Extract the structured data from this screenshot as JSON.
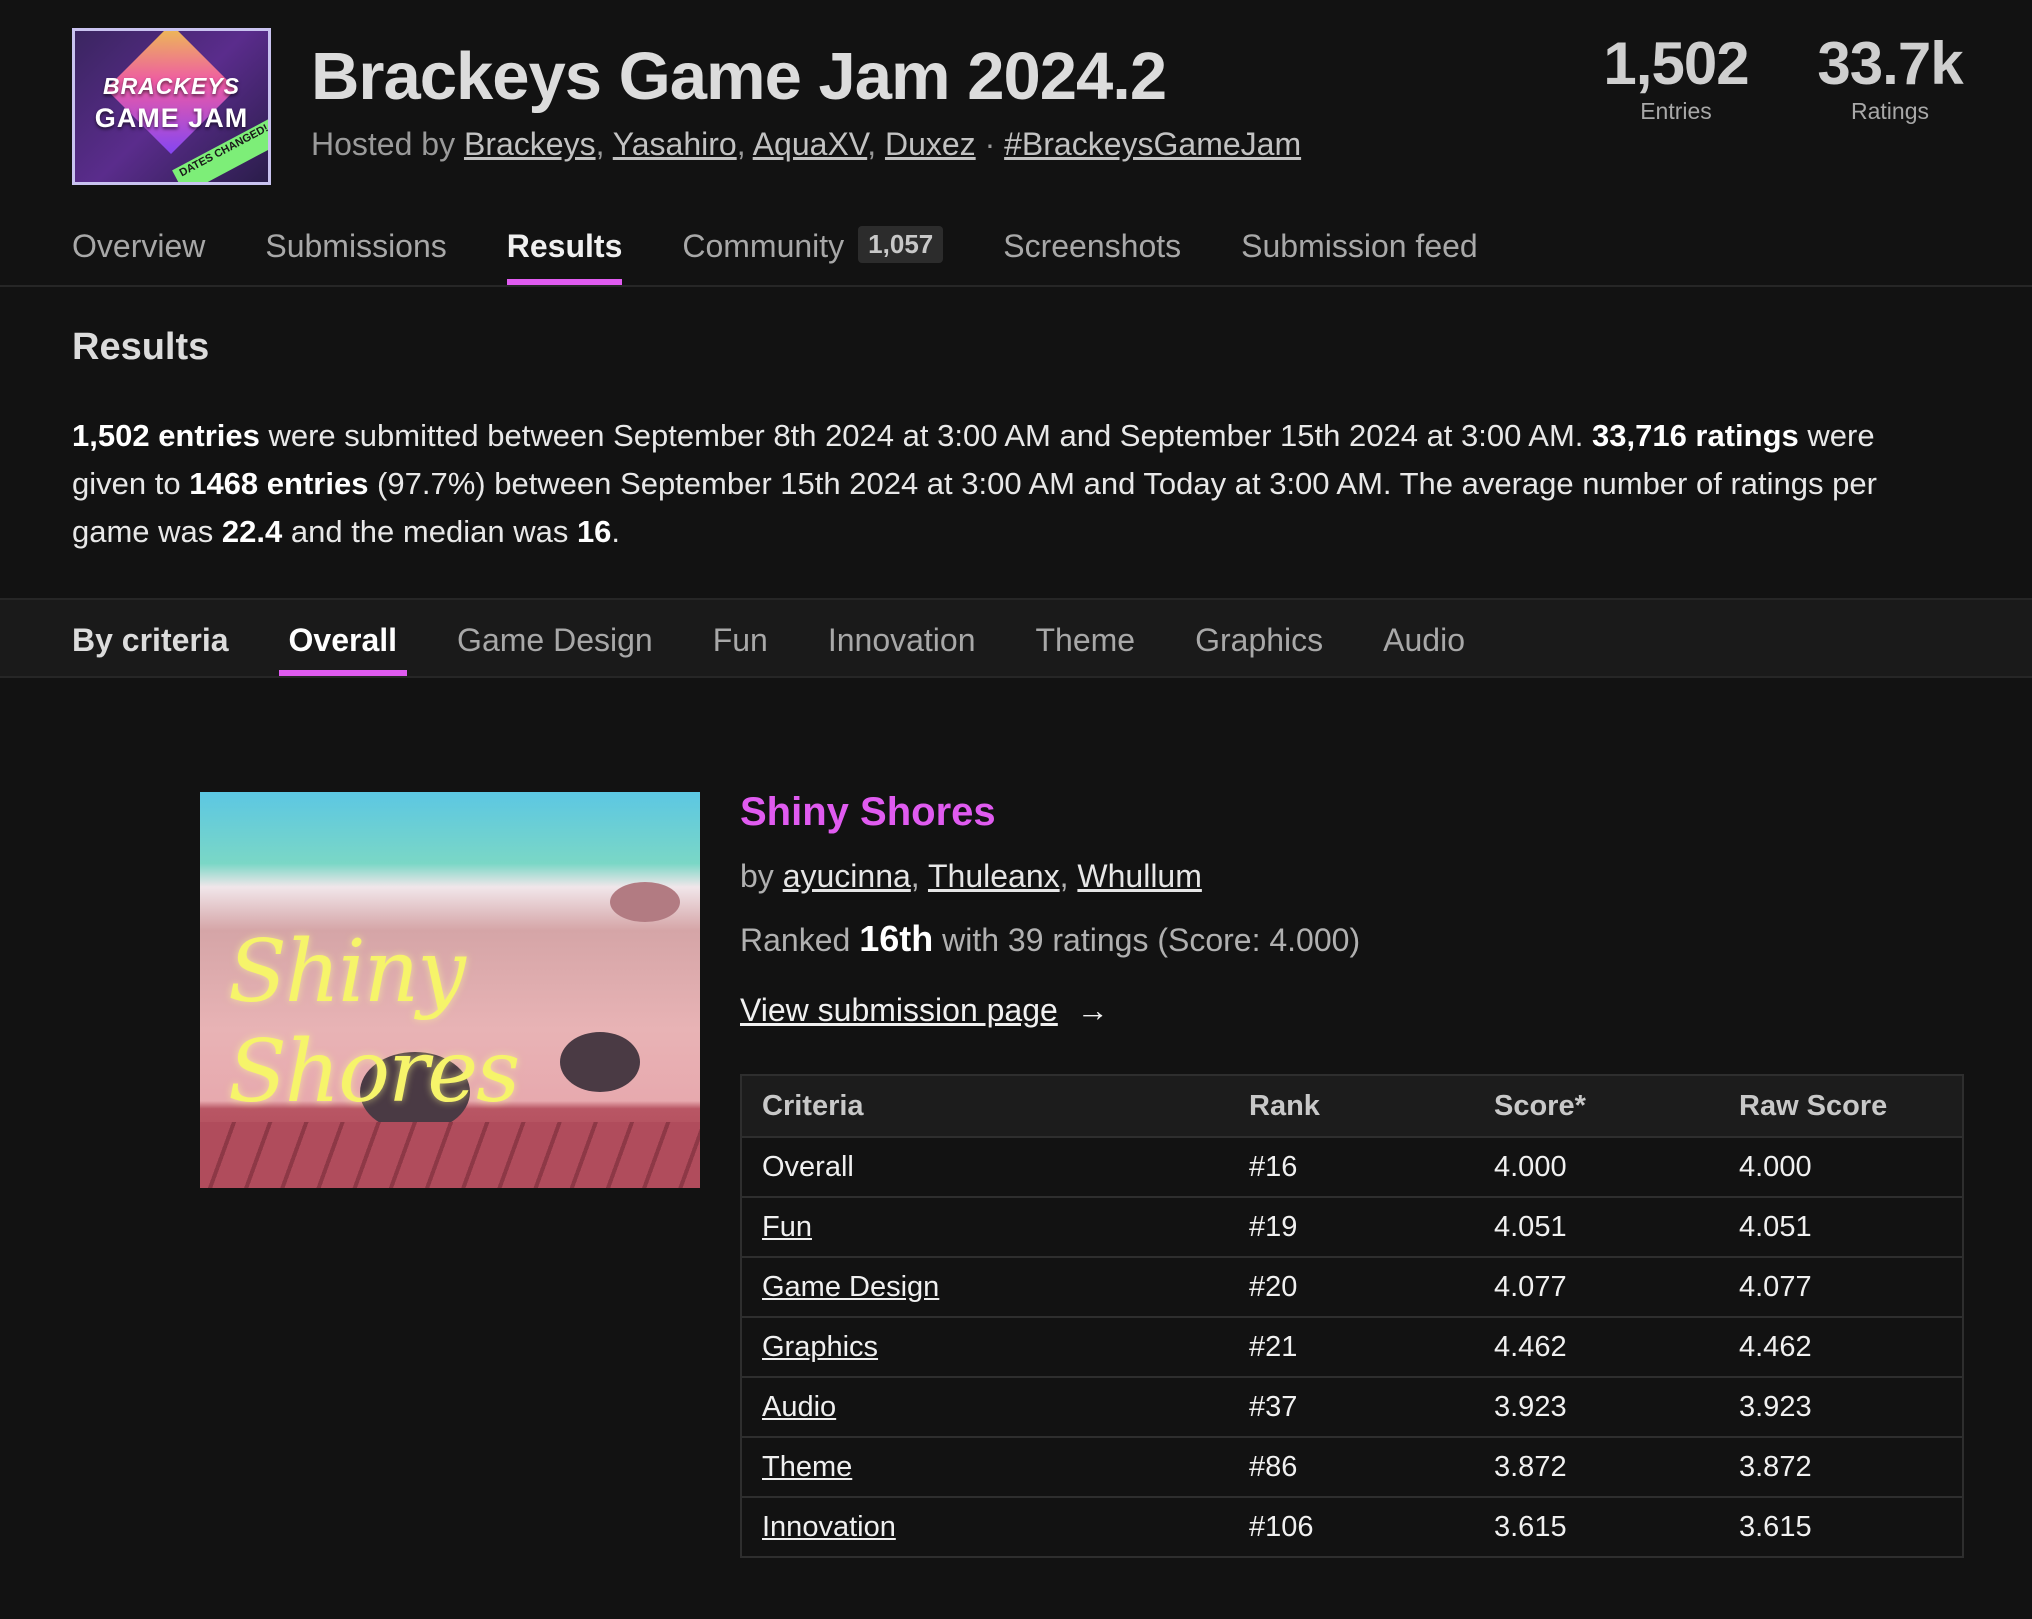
{
  "header": {
    "logo_line1": "BRACKEYS",
    "logo_line2": "GAME JAM",
    "logo_ribbon": "DATES CHANGED!",
    "title": "Brackeys Game Jam 2024.2",
    "hosted_prefix": "Hosted by",
    "hosts": [
      "Brackeys",
      "Yasahiro",
      "AquaXV",
      "Duxez"
    ],
    "separator": "·",
    "hashtag": "#BrackeysGameJam",
    "stats": [
      {
        "value": "1,502",
        "label": "Entries"
      },
      {
        "value": "33.7k",
        "label": "Ratings"
      }
    ]
  },
  "nav": {
    "items": [
      {
        "label": "Overview"
      },
      {
        "label": "Submissions"
      },
      {
        "label": "Results"
      },
      {
        "label": "Community",
        "badge": "1,057"
      },
      {
        "label": "Screenshots"
      },
      {
        "label": "Submission feed"
      }
    ],
    "active": "Results"
  },
  "results": {
    "heading": "Results",
    "summary": {
      "entries": "1,502 entries",
      "t1": " were submitted between September 8th 2024 at 3:00 AM and September 15th 2024 at 3:00 AM. ",
      "ratings": "33,716 ratings",
      "t2": " were given to ",
      "rated_entries": "1468 entries",
      "t3": " (97.7%) between September 15th 2024 at 3:00 AM and Today at 3:00 AM. The average number of ratings per game was ",
      "average": "22.4",
      "t4": " and the median was ",
      "median": "16",
      "t5": "."
    }
  },
  "criteria_nav": {
    "label": "By criteria",
    "items": [
      "Overall",
      "Game Design",
      "Fun",
      "Innovation",
      "Theme",
      "Graphics",
      "Audio"
    ],
    "active": "Overall"
  },
  "entry": {
    "thumbnail_text": "Shiny Shores",
    "title": "Shiny Shores",
    "by_prefix": "by",
    "authors": [
      "ayucinna",
      "Thuleanx",
      "Whullum"
    ],
    "ranked_prefix": "Ranked",
    "rank": "16th",
    "ranked_suffix": "with 39 ratings (Score: 4.000)",
    "view_link": "View submission page",
    "view_arrow": "→",
    "table": {
      "headers": [
        "Criteria",
        "Rank",
        "Score*",
        "Raw Score"
      ],
      "rows": [
        {
          "criteria": "Overall",
          "rank": "#16",
          "score": "4.000",
          "raw": "4.000"
        },
        {
          "criteria": "Fun",
          "rank": "#19",
          "score": "4.051",
          "raw": "4.051"
        },
        {
          "criteria": "Game Design",
          "rank": "#20",
          "score": "4.077",
          "raw": "4.077"
        },
        {
          "criteria": "Graphics",
          "rank": "#21",
          "score": "4.462",
          "raw": "4.462"
        },
        {
          "criteria": "Audio",
          "rank": "#37",
          "score": "3.923",
          "raw": "3.923"
        },
        {
          "criteria": "Theme",
          "rank": "#86",
          "score": "3.872",
          "raw": "3.872"
        },
        {
          "criteria": "Innovation",
          "rank": "#106",
          "score": "3.615",
          "raw": "3.615"
        }
      ]
    }
  },
  "colors": {
    "background": "#121212",
    "accent": "#e05bf0"
  }
}
